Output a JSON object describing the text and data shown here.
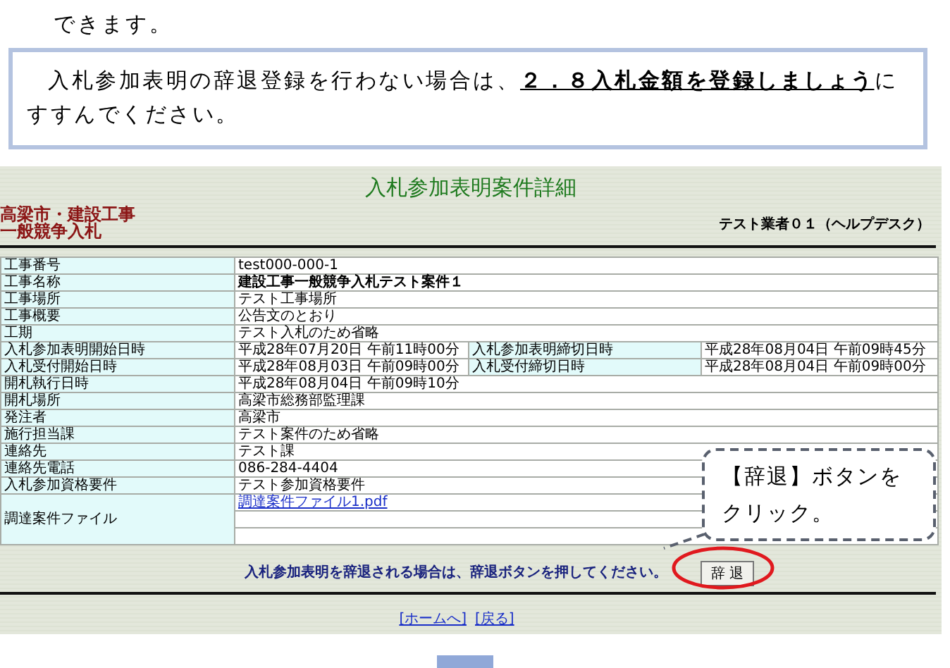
{
  "document": {
    "intro_tail": "できます。",
    "note": "入札参加表明の辞退登録を行わない場合は、**２．８入札金額を登録しましょう**にすすんでください。"
  },
  "screen": {
    "title": "入札参加表明案件詳細",
    "org_lines": [
      "高梁市・建設工事",
      "一般競争入札"
    ],
    "user": "テスト業者０１（ヘルプデスク）",
    "rows": [
      {
        "kind": "text",
        "label": "工事番号",
        "value": "test000-000-1"
      },
      {
        "kind": "emphasis",
        "label": "工事名称",
        "value": "建設工事一般競争入札テスト案件１"
      },
      {
        "kind": "text",
        "label": "工事場所",
        "value": "テスト工事場所"
      },
      {
        "kind": "text",
        "label": "工事概要",
        "value": "公告文のとおり"
      },
      {
        "kind": "text",
        "label": "工期",
        "value": "テスト入札のため省略"
      },
      {
        "kind": "pair",
        "label": "入札参加表明開始日時",
        "value": "平成28年07月20日 午前11時00分",
        "label2": "入札参加表明締切日時",
        "value2": "平成28年08月04日 午前09時45分"
      },
      {
        "kind": "pair",
        "label": "入札受付開始日時",
        "value": "平成28年08月03日 午前09時00分",
        "label2": "入札受付締切日時",
        "value2": "平成28年08月04日 午前09時00分"
      },
      {
        "kind": "text",
        "label": "開札執行日時",
        "value": "平成28年08月04日 午前09時10分"
      },
      {
        "kind": "text",
        "label": "開札場所",
        "value": "高梁市総務部監理課"
      },
      {
        "kind": "text",
        "label": "発注者",
        "value": "高梁市"
      },
      {
        "kind": "text",
        "label": "施行担当課",
        "value": "テスト案件のため省略"
      },
      {
        "kind": "text",
        "label": "連絡先",
        "value": "テスト課"
      },
      {
        "kind": "text",
        "label": "連絡先電話",
        "value": "086-284-4404"
      },
      {
        "kind": "text",
        "label": "入札参加資格要件",
        "value": "テスト参加資格要件"
      },
      {
        "kind": "files",
        "label": "調達案件ファイル",
        "files": [
          "調達案件ファイル1.pdf"
        ]
      }
    ],
    "withdraw_message": "入札参加表明を辞退される場合は、辞退ボタンを押してください。",
    "withdraw_button": "辞 退",
    "nav_links": [
      "[ホームへ]",
      "[戻る]"
    ]
  },
  "callout": "【辞退】ボタンをクリック。"
}
